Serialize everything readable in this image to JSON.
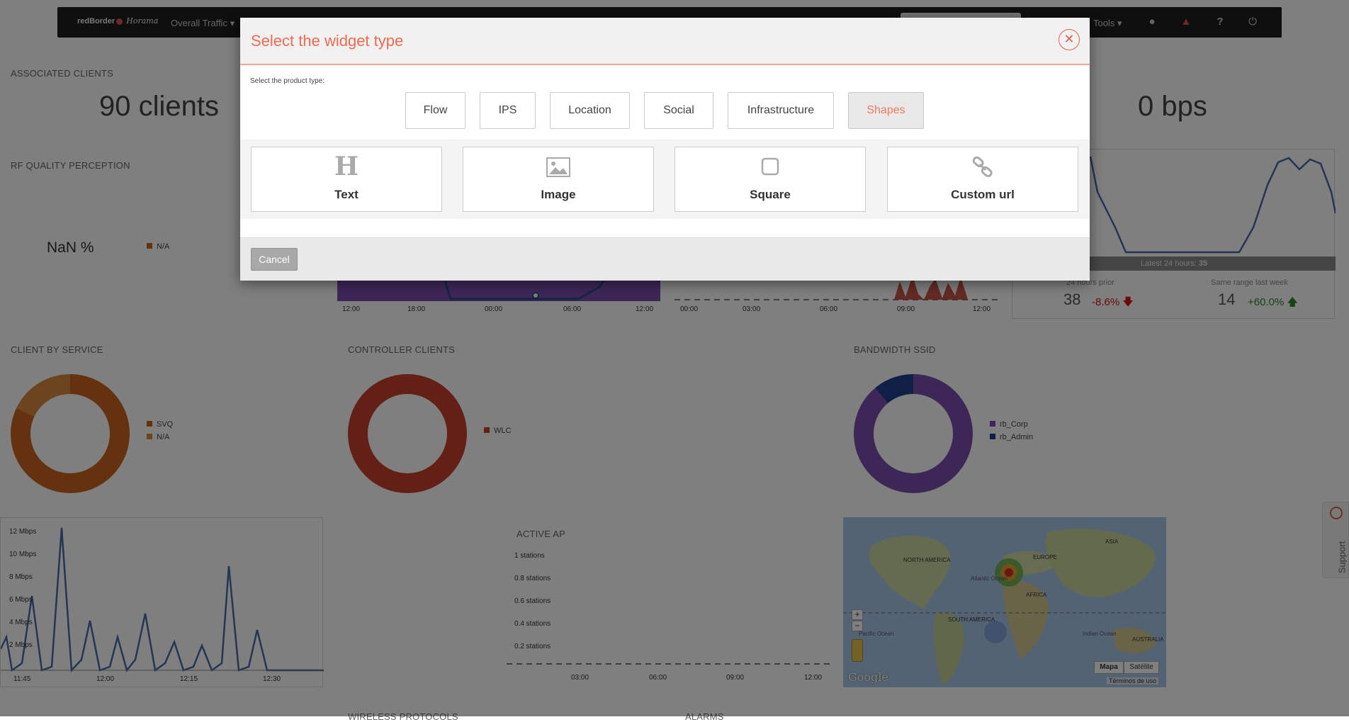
{
  "navbar": {
    "brand": "redBorder",
    "brand_sub": "Horama",
    "menu_overall": "Overall Traffic",
    "tools": "Tools"
  },
  "widgets": {
    "associated_clients": {
      "title": "ASSOCIATED CLIENTS",
      "value": "90 clients"
    },
    "bps_value": "0 bps",
    "rf_quality": {
      "title": "RF QUALITY PERCEPTION",
      "value": "NaN %",
      "legend": "N/A"
    },
    "trend": {
      "latest_label": "Latest 24 hours:",
      "latest_value": "35",
      "prior_label": "24 hours prior",
      "prior_value": "38",
      "prior_change": "-8.6%",
      "last_week_label": "Same range last week",
      "last_week_value": "14",
      "last_week_change": "+60.0%"
    },
    "purple_ticks": [
      "12:00",
      "18:00",
      "00:00",
      "06:00",
      "12:00"
    ],
    "red_ticks": [
      "00:00",
      "03:00",
      "06:00",
      "09:00",
      "12:00"
    ],
    "client_by_service": {
      "title": "CLIENT BY SERVICE",
      "legend": [
        "SVQ",
        "N/A"
      ]
    },
    "controller_clients": {
      "title": "CONTROLLER CLIENTS",
      "legend": [
        "WLC"
      ]
    },
    "bandwidth_ssid": {
      "title": "BANDWIDTH SSID",
      "legend": [
        "rb_Corp",
        "rb_Admin"
      ]
    },
    "bandwidth_chart": {
      "y_ticks": [
        "12 Mbps",
        "10 Mbps",
        "8 Mbps",
        "6 Mbps",
        "4 Mbps",
        "2 Mbps"
      ],
      "x_ticks": [
        "11:45",
        "12:00",
        "12:15",
        "12:30"
      ]
    },
    "active_ap": {
      "title": "ACTIVE AP",
      "y_ticks": [
        "1 stations",
        "0.8 stations",
        "0.6 stations",
        "0.4 stations",
        "0.2 stations"
      ],
      "x_ticks": [
        "03:00",
        "06:00",
        "09:00",
        "12:00"
      ]
    },
    "map": {
      "labels": [
        "NORTH AMERICA",
        "EUROPE",
        "ASIA",
        "Atlantic Ocean",
        "AFRICA",
        "SOUTH AMERICA",
        "Pacific Ocean",
        "Indian Ocean",
        "AUSTRALIA"
      ],
      "btn_map": "Mapa",
      "btn_satellite": "Satélite",
      "google": "Google",
      "terms": "Términos de uso"
    },
    "bottom_titles": [
      "WIRELESS PROTOCOLS",
      "ALARMS"
    ],
    "support": "Support"
  },
  "modal": {
    "title": "Select the widget type",
    "product_label": "Select the product type:",
    "product_types": [
      "Flow",
      "IPS",
      "Location",
      "Social",
      "Infrastructure",
      "Shapes"
    ],
    "active_product": "Shapes",
    "widget_types": [
      {
        "label": "Text",
        "icon": "heading-icon"
      },
      {
        "label": "Image",
        "icon": "picture-icon"
      },
      {
        "label": "Square",
        "icon": "square-icon"
      },
      {
        "label": "Custom url",
        "icon": "link-icon"
      }
    ],
    "cancel_label": "Cancel"
  },
  "colors": {
    "accent": "#ef6a50",
    "purple": "#7b4fb0",
    "orange": "#c8641e",
    "red": "#c8402e",
    "navy": "#1f3f8c",
    "line_blue": "#2d4a8a"
  }
}
